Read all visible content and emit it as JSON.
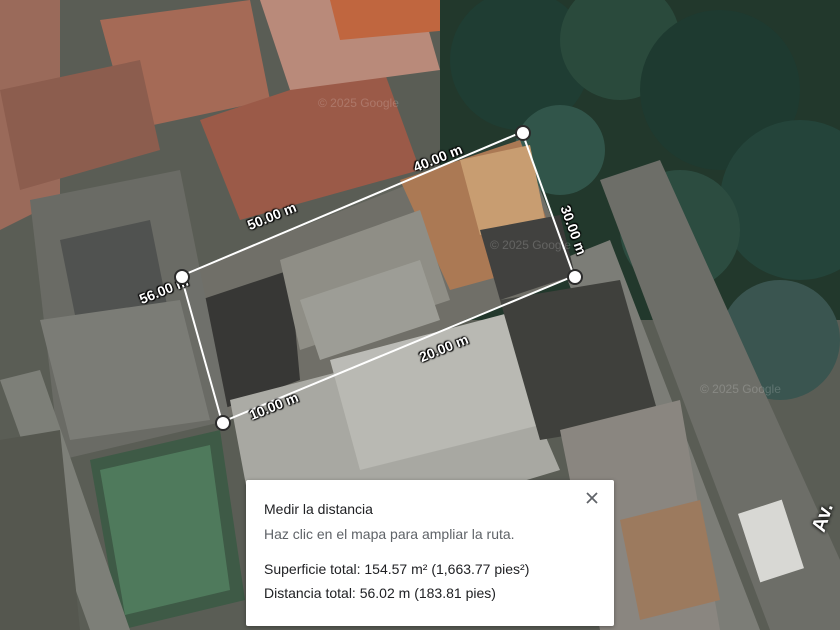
{
  "measure_panel": {
    "title": "Medir la distancia",
    "hint": "Haz clic en el mapa para ampliar la ruta.",
    "area_label": "Superficie total:",
    "area_value": "154.57 m² (1,663.77 pies²)",
    "distance_label": "Distancia total:",
    "distance_value": "56.02 m (183.81 pies)",
    "close_icon": "close-icon"
  },
  "map": {
    "view": "satellite",
    "street_label": "Av.",
    "watermark": "© 2025 Google",
    "segment_labels": {
      "a": "10.00 m",
      "b": "20.00 m",
      "c": "30.00 m",
      "d": "40.00 m",
      "e": "50.00 m",
      "f": "56.00 m"
    }
  },
  "colors": {
    "measure_line": "#ffffff",
    "panel_bg": "#ffffff",
    "text_primary": "#202124",
    "text_secondary": "#5f6368"
  }
}
